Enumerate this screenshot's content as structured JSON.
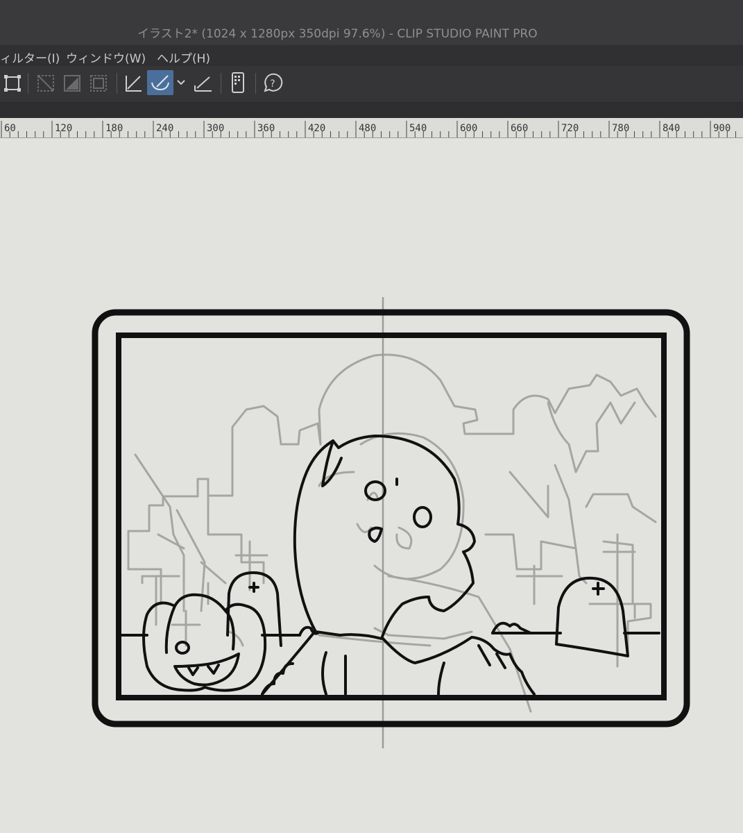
{
  "window": {
    "title": "イラスト2* (1024 x 1280px 350dpi 97.6%)  - CLIP STUDIO PAINT PRO"
  },
  "menubar": {
    "items": [
      "ィルター(I)",
      "ウィンドウ(W)",
      "ヘルプ(H)"
    ]
  },
  "toolbar": {
    "icons": [
      "transform-icon",
      "hide-selection-icon",
      "fill-selection-icon",
      "clear-selection-icon",
      "line-snap-icon",
      "brush-stabilize-icon",
      "dropdown-icon",
      "ruler-snap-icon",
      "smartphone-icon",
      "help-icon"
    ]
  },
  "ruler": {
    "ticks": [
      "60",
      "120",
      "180",
      "240",
      "300",
      "360",
      "420",
      "480",
      "540",
      "600",
      "660",
      "720",
      "780",
      "840",
      "900"
    ]
  },
  "canvas": {
    "background": "#e2e3df",
    "ink_color": "#111111",
    "sketch_color": "#a5a6a3",
    "guide_color": "#9c9c9a"
  },
  "colors": {
    "titlebar": "#3a3a3c",
    "menubar": "#303032",
    "toolbar_active": "#4b6f9b"
  }
}
